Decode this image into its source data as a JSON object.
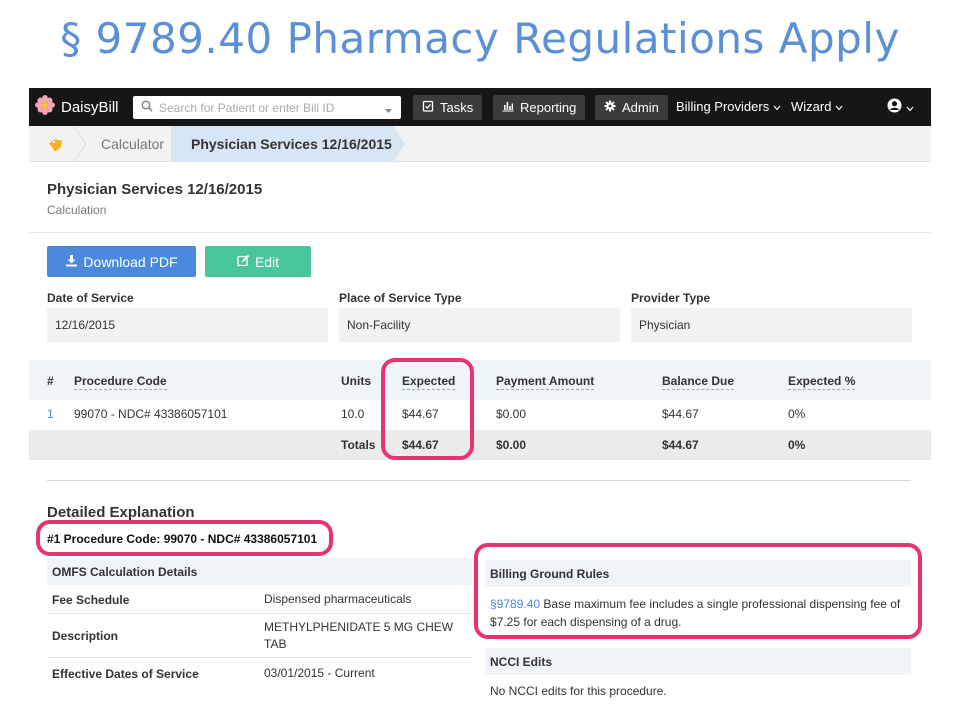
{
  "slide": {
    "title": "§ 9789.40 Pharmacy Regulations Apply"
  },
  "navbar": {
    "brand": "DaisyBill",
    "search_placeholder": "Search for Patient or enter Bill ID",
    "tasks": "Tasks",
    "reporting": "Reporting",
    "admin": "Admin",
    "billing_providers": "Billing Providers",
    "wizard": "Wizard"
  },
  "breadcrumb": {
    "calculator": "Calculator",
    "current": "Physician Services 12/16/2015"
  },
  "page": {
    "title": "Physician Services 12/16/2015",
    "subtitle": "Calculation",
    "download_pdf": "Download PDF",
    "edit": "Edit"
  },
  "fields": {
    "date_label": "Date of Service",
    "date_value": "12/16/2015",
    "place_label": "Place of Service Type",
    "place_value": "Non-Facility",
    "provider_label": "Provider Type",
    "provider_value": "Physician"
  },
  "fee_table": {
    "headers": [
      "#",
      "Procedure Code",
      "Units",
      "Expected",
      "Payment Amount",
      "Balance Due",
      "Expected %"
    ],
    "row": {
      "num": "1",
      "code": "99070 - NDC# 43386057101",
      "units": "10.0",
      "expected": "$44.67",
      "payment": "$0.00",
      "balance": "$44.67",
      "pct": "0%"
    },
    "totals": {
      "label": "Totals",
      "expected": "$44.67",
      "payment": "$0.00",
      "balance": "$44.67",
      "pct": "0%"
    }
  },
  "detail": {
    "title": "Detailed Explanation",
    "procedure": "#1 Procedure Code: 99070 - NDC# 43386057101",
    "omfs_header": "OMFS Calculation Details",
    "fee_schedule_label": "Fee Schedule",
    "fee_schedule_value": "Dispensed pharmaceuticals",
    "description_label": "Description",
    "description_value": "METHYLPHENIDATE 5 MG CHEW TAB",
    "effective_label": "Effective Dates of Service",
    "effective_value": "03/01/2015 - Current",
    "rules_header": "Billing Ground Rules",
    "rules_ref": "§9789.40",
    "rules_text": " Base maximum fee includes a single professional dispensing fee of $7.25 for each dispensing of a drug.",
    "ncci_header": "NCCI Edits",
    "ncci_text": "No NCCI edits for this procedure."
  },
  "colors": {
    "accent": "#4a89dc",
    "edit": "#48c79a",
    "highlight": "#e8336d",
    "title": "#5b8fd6"
  },
  "icons": [
    "daisy-logo-icon",
    "search-icon",
    "chevron-down-icon",
    "tasks-icon",
    "reporting-icon",
    "gear-icon",
    "user-icon",
    "home-tag-icon",
    "download-icon",
    "edit-icon"
  ]
}
